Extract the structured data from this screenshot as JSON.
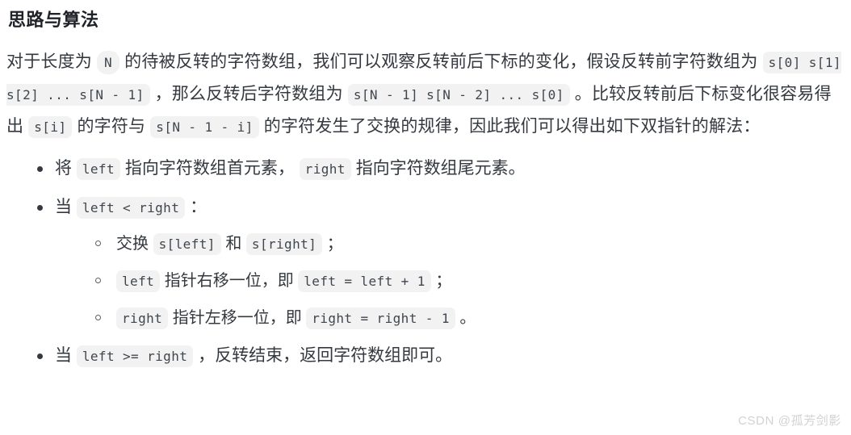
{
  "document": {
    "heading": "思路与算法",
    "paragraph": {
      "p1": "对于长度为",
      "code_n": "N",
      "p2": "的待被反转的字符数组，我们可以观察反转前后下标的变化，假设反转前字符数组为",
      "code_before": "s[0] s[1] s[2] ... s[N - 1]",
      "p3": "，那么反转后字符数组为",
      "code_after": "s[N - 1] s[N - 2] ... s[0]",
      "p4": "。比较反转前后下标变化很容易得出",
      "code_si": "s[i]",
      "p5": "的字符与",
      "code_sni": "s[N - 1 - i]",
      "p6": "的字符发生了交换的规律，因此我们可以得出如下双指针的解法："
    },
    "steps": [
      {
        "id": "step-init",
        "parts": [
          {
            "type": "text",
            "value": "将"
          },
          {
            "type": "code",
            "value": "left"
          },
          {
            "type": "text",
            "value": "指向字符数组首元素，"
          },
          {
            "type": "code",
            "value": "right"
          },
          {
            "type": "text",
            "value": "指向字符数组尾元素。"
          }
        ]
      },
      {
        "id": "step-loop",
        "parts": [
          {
            "type": "text",
            "value": "当"
          },
          {
            "type": "code",
            "value": "left < right"
          },
          {
            "type": "text",
            "value": "："
          }
        ],
        "substeps": [
          {
            "id": "substep-swap",
            "parts": [
              {
                "type": "text",
                "value": "交换"
              },
              {
                "type": "code",
                "value": "s[left]"
              },
              {
                "type": "text",
                "value": "和"
              },
              {
                "type": "code",
                "value": "s[right]"
              },
              {
                "type": "text",
                "value": "；"
              }
            ]
          },
          {
            "id": "substep-left-move",
            "parts": [
              {
                "type": "code",
                "value": "left"
              },
              {
                "type": "text",
                "value": "指针右移一位，即"
              },
              {
                "type": "code",
                "value": "left = left + 1"
              },
              {
                "type": "text",
                "value": "；"
              }
            ]
          },
          {
            "id": "substep-right-move",
            "parts": [
              {
                "type": "code",
                "value": "right"
              },
              {
                "type": "text",
                "value": "指针左移一位，即"
              },
              {
                "type": "code",
                "value": "right = right - 1"
              },
              {
                "type": "text",
                "value": "。"
              }
            ]
          }
        ]
      },
      {
        "id": "step-end",
        "parts": [
          {
            "type": "text",
            "value": "当"
          },
          {
            "type": "code",
            "value": "left >= right"
          },
          {
            "type": "text",
            "value": "，反转结束，返回字符数组即可。"
          }
        ]
      }
    ]
  },
  "watermark": {
    "text": "CSDN @孤芳剑影"
  },
  "colors": {
    "text": "#34393f",
    "heading": "#1f2329",
    "code_bg": "#f2f2f3",
    "code_fg": "#40464d",
    "watermark": "#d2d2d2",
    "page_bg": "#ffffff"
  }
}
